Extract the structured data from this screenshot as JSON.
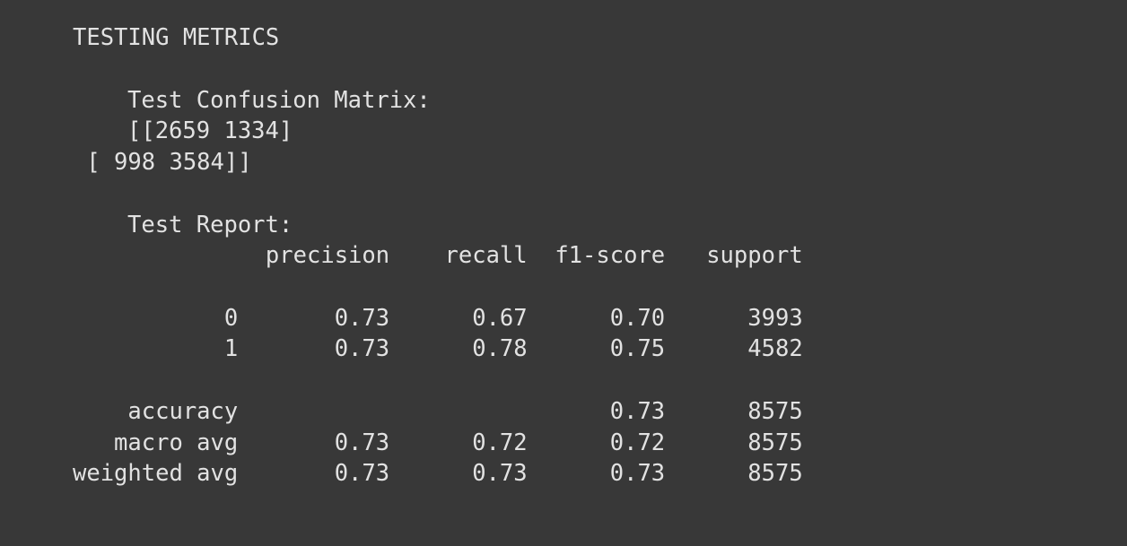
{
  "output": {
    "heading": "TESTING METRICS",
    "confusion_title": "Test Confusion Matrix:",
    "matrix_row_1": "[[2659 1334]",
    "matrix_row_2": " [ 998 3584]]",
    "report_title": "Test Report:",
    "report_header": "              precision    recall  f1-score   support",
    "report_rows": [
      "           0       0.73      0.67      0.70      3993",
      "           1       0.73      0.78      0.75      4582",
      "    accuracy                           0.73      8575",
      "   macro avg       0.73      0.72      0.72      8575",
      "weighted avg       0.73      0.73      0.73      8575"
    ]
  }
}
